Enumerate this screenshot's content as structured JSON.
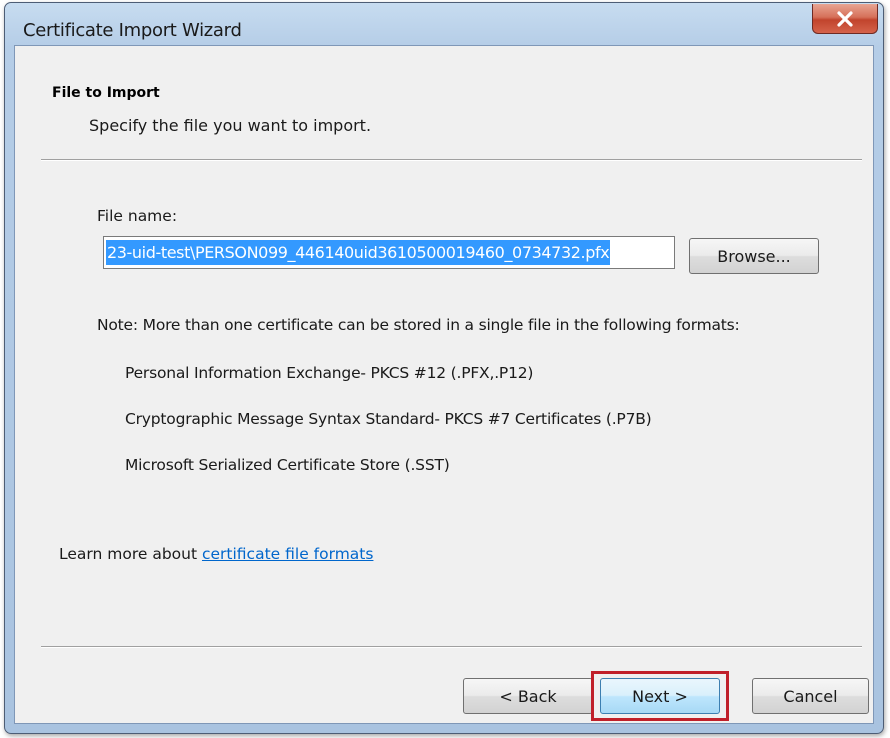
{
  "window": {
    "title": "Certificate Import Wizard",
    "close_icon": "close-x-icon"
  },
  "header": {
    "title": "File to Import",
    "subtitle": "Specify the file you want to import."
  },
  "file": {
    "label": "File name:",
    "value": "23-uid-test\\PERSON099_446140uid3610500019460_0734732.pfx",
    "browse_label": "Browse..."
  },
  "note": {
    "text": "Note:  More than one certificate can be stored in a single file in the following formats:",
    "formats": [
      "Personal Information Exchange- PKCS #12 (.PFX,.P12)",
      "Cryptographic Message Syntax Standard- PKCS #7 Certificates (.P7B)",
      "Microsoft Serialized Certificate Store (.SST)"
    ]
  },
  "learn_more": {
    "prefix": "Learn more about ",
    "link_text": "certificate file formats"
  },
  "footer": {
    "back_label": "< Back",
    "next_label": "Next >",
    "cancel_label": "Cancel"
  },
  "colors": {
    "selection": "#3399ff",
    "link": "#0066cc",
    "highlight_box": "#c0202a",
    "close_button": "#c1442d"
  }
}
